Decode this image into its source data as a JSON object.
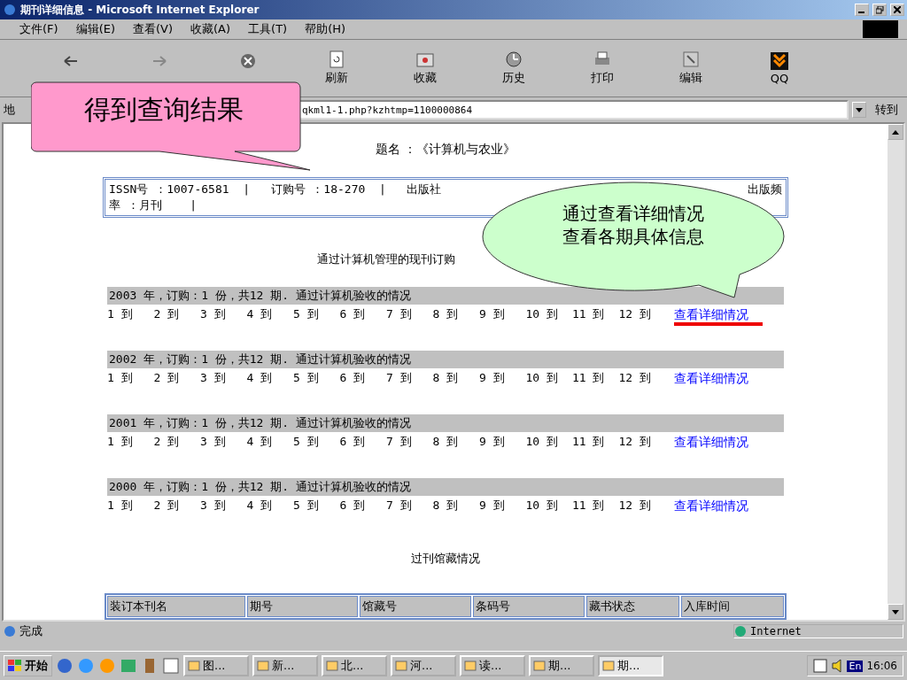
{
  "window": {
    "title": "期刊详细信息 - Microsoft Internet Explorer"
  },
  "menu": [
    "文件(F)",
    "编辑(E)",
    "查看(V)",
    "收藏(A)",
    "工具(T)",
    "帮助(H)"
  ],
  "toolbar": [
    {
      "kind": "back"
    },
    {
      "kind": "forward"
    },
    {
      "kind": "stop"
    },
    {
      "kind": "refresh",
      "label": "刷新"
    },
    {
      "kind": "favorites",
      "label": "收藏"
    },
    {
      "kind": "history",
      "label": "历史"
    },
    {
      "kind": "print",
      "label": "打印"
    },
    {
      "kind": "edit",
      "label": "编辑"
    },
    {
      "kind": "qq",
      "label": "QQ"
    }
  ],
  "address": {
    "label": "地",
    "value": "qkml1-1.php?kzhtmp=1100000864",
    "go": "转到"
  },
  "page": {
    "title": "题名 ：《计算机与农业》",
    "info_line1": "ISSN号 ：1007-6581  |   订购号 ：18-270  |   出版社",
    "info_right": "出版频",
    "info_line2": "率 ：月刊    |",
    "current_heading": "通过计算机管理的现刊订购",
    "years": [
      {
        "header": "2003 年，订购：1 份，共12 期. 通过计算机验收的情况",
        "issues": [
          "1 到",
          "2 到",
          "3 到",
          "4 到",
          "5 到",
          "6 到",
          "7 到",
          "8 到",
          "9 到",
          "10 到",
          "11 到",
          "12 到"
        ],
        "link": "查看详细情况",
        "highlighted": true
      },
      {
        "header": "2002 年，订购：1 份，共12 期. 通过计算机验收的情况",
        "issues": [
          "1 到",
          "2 到",
          "3 到",
          "4 到",
          "5 到",
          "6 到",
          "7 到",
          "8 到",
          "9 到",
          "10 到",
          "11 到",
          "12 到"
        ],
        "link": "查看详细情况",
        "highlighted": false
      },
      {
        "header": "2001 年，订购：1 份，共12 期. 通过计算机验收的情况",
        "issues": [
          "1 到",
          "2 到",
          "3 到",
          "4 到",
          "5 到",
          "6 到",
          "7 到",
          "8 到",
          "9 到",
          "10 到",
          "11 到",
          "12 到"
        ],
        "link": "查看详细情况",
        "highlighted": false
      },
      {
        "header": "2000 年，订购：1 份，共12 期. 通过计算机验收的情况",
        "issues": [
          "1 到",
          "2 到",
          "3 到",
          "4 到",
          "5 到",
          "6 到",
          "7 到",
          "8 到",
          "9 到",
          "10 到",
          "11 到",
          "12 到"
        ],
        "link": "查看详细情况",
        "highlighted": false
      }
    ],
    "archive_heading": "过刊馆藏情况",
    "archive_columns": [
      "装订本刊名",
      "期号",
      "馆藏号",
      "条码号",
      "藏书状态",
      "入库时间"
    ]
  },
  "callouts": [
    {
      "kind": "rect",
      "text": "得到查询结果"
    },
    {
      "kind": "ellipse",
      "lines": [
        "通过查看详细情况",
        "查看各期具体信息"
      ]
    }
  ],
  "status_bar": {
    "text": "完成",
    "zone": "Internet"
  },
  "taskbar": {
    "start": "开始",
    "tasks": [
      {
        "label": "图...",
        "selected": false
      },
      {
        "label": "新...",
        "selected": false
      },
      {
        "label": "北...",
        "selected": false
      },
      {
        "label": "河...",
        "selected": false
      },
      {
        "label": "读...",
        "selected": false
      },
      {
        "label": "期...",
        "selected": false
      },
      {
        "label": "期...",
        "selected": true
      }
    ],
    "tray_lang": "En",
    "clock": "16:06"
  }
}
